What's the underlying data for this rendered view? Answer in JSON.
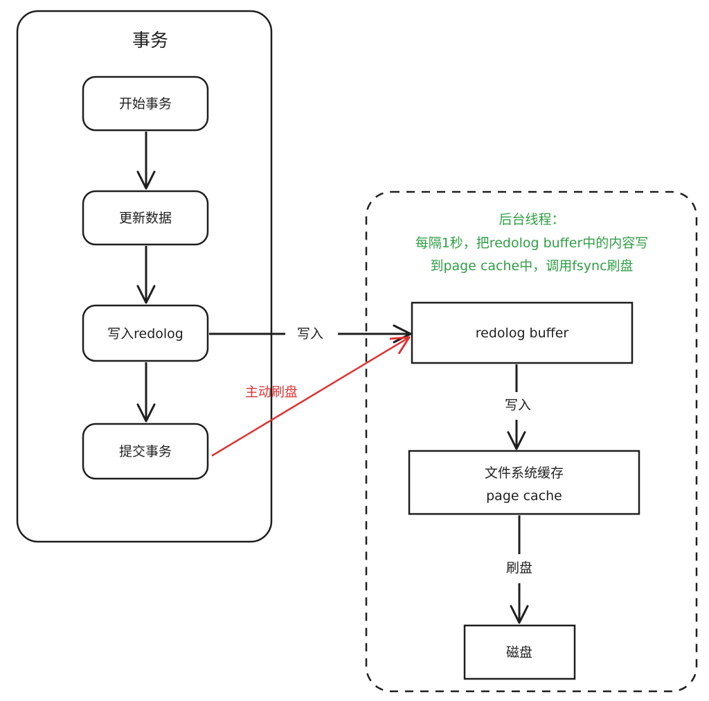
{
  "transaction": {
    "title": "事务",
    "steps": {
      "start": "开始事务",
      "update": "更新数据",
      "write_redolog": "写入redolog",
      "commit": "提交事务"
    }
  },
  "background": {
    "note_line1": "后台线程：",
    "note_line2": "每隔1秒，把redolog buffer中的内容写",
    "note_line3": "到page cache中，调用fsync刷盘",
    "redolog_buffer": "redolog buffer",
    "page_cache_line1": "文件系统缓存",
    "page_cache_line2": "page cache",
    "disk": "磁盘"
  },
  "edges": {
    "write_to_buffer": "写入",
    "active_flush": "主动刷盘",
    "buffer_to_cache": "写入",
    "cache_to_disk": "刷盘"
  },
  "colors": {
    "stroke": "#1e1e1e",
    "note_green": "#2f9e44",
    "active_flush_red": "#e03131"
  }
}
